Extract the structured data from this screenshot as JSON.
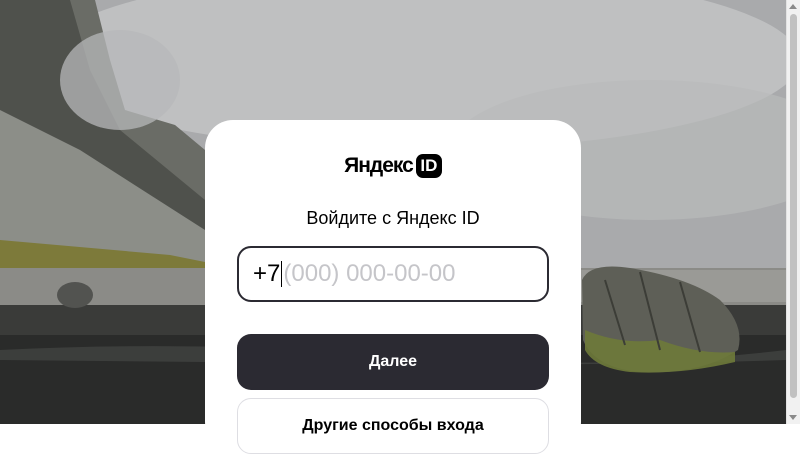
{
  "logo": {
    "wordmark": "Яндекс",
    "badge": "ID"
  },
  "login": {
    "title": "Войдите с Яндекс ID",
    "phone_prefix": "+7",
    "phone_placeholder": "(000) 000-00-00",
    "next_button": "Далее",
    "other_methods_button": "Другие способы входа"
  },
  "colors": {
    "primary_button": "#2b2a32",
    "card_background": "#ffffff",
    "placeholder": "#c5c5c9"
  }
}
